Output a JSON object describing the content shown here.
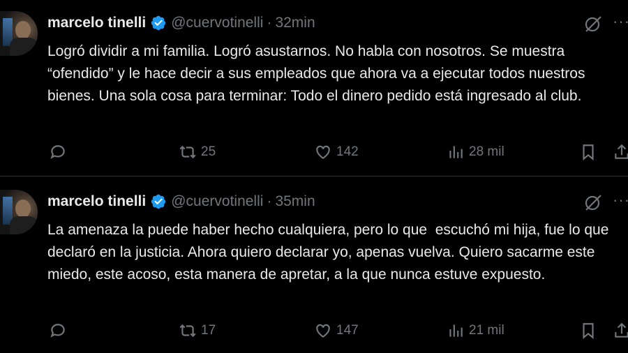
{
  "colors": {
    "background": "#000000",
    "text": "#e7e9ea",
    "muted": "#71767b",
    "verified": "#1d9bf0"
  },
  "tweets": [
    {
      "name": "marcelo tinelli",
      "handle": "@cuervotinelli",
      "separator": "·",
      "time": "32min",
      "text": "Logró dividir a mi familia. Logró asustarnos. No habla con nosotros. Se muestra “ofendido” y le hace decir a sus empleados que ahora va a ejecutar todos nuestros bienes. Una sola cosa para terminar: Todo el dinero pedido está ingresado al club.",
      "retweets": "25",
      "likes": "142",
      "views": "28 mil"
    },
    {
      "name": "marcelo tinelli",
      "handle": "@cuervotinelli",
      "separator": "·",
      "time": "35min",
      "text": "La amenaza la puede haber hecho cualquiera, pero lo que  escuchó mi hija, fue lo que declaró en la justicia. Ahora quiero declarar yo, apenas vuelva. Quiero sacarme este miedo, este acoso, esta manera de apretar, a la que nunca estuve expuesto.",
      "retweets": "17",
      "likes": "147",
      "views": "21 mil"
    }
  ],
  "icons": [
    "reply-icon",
    "retweet-icon",
    "like-icon",
    "views-icon",
    "bookmark-icon",
    "share-icon",
    "grok-icon",
    "more-icon",
    "verified-icon"
  ]
}
